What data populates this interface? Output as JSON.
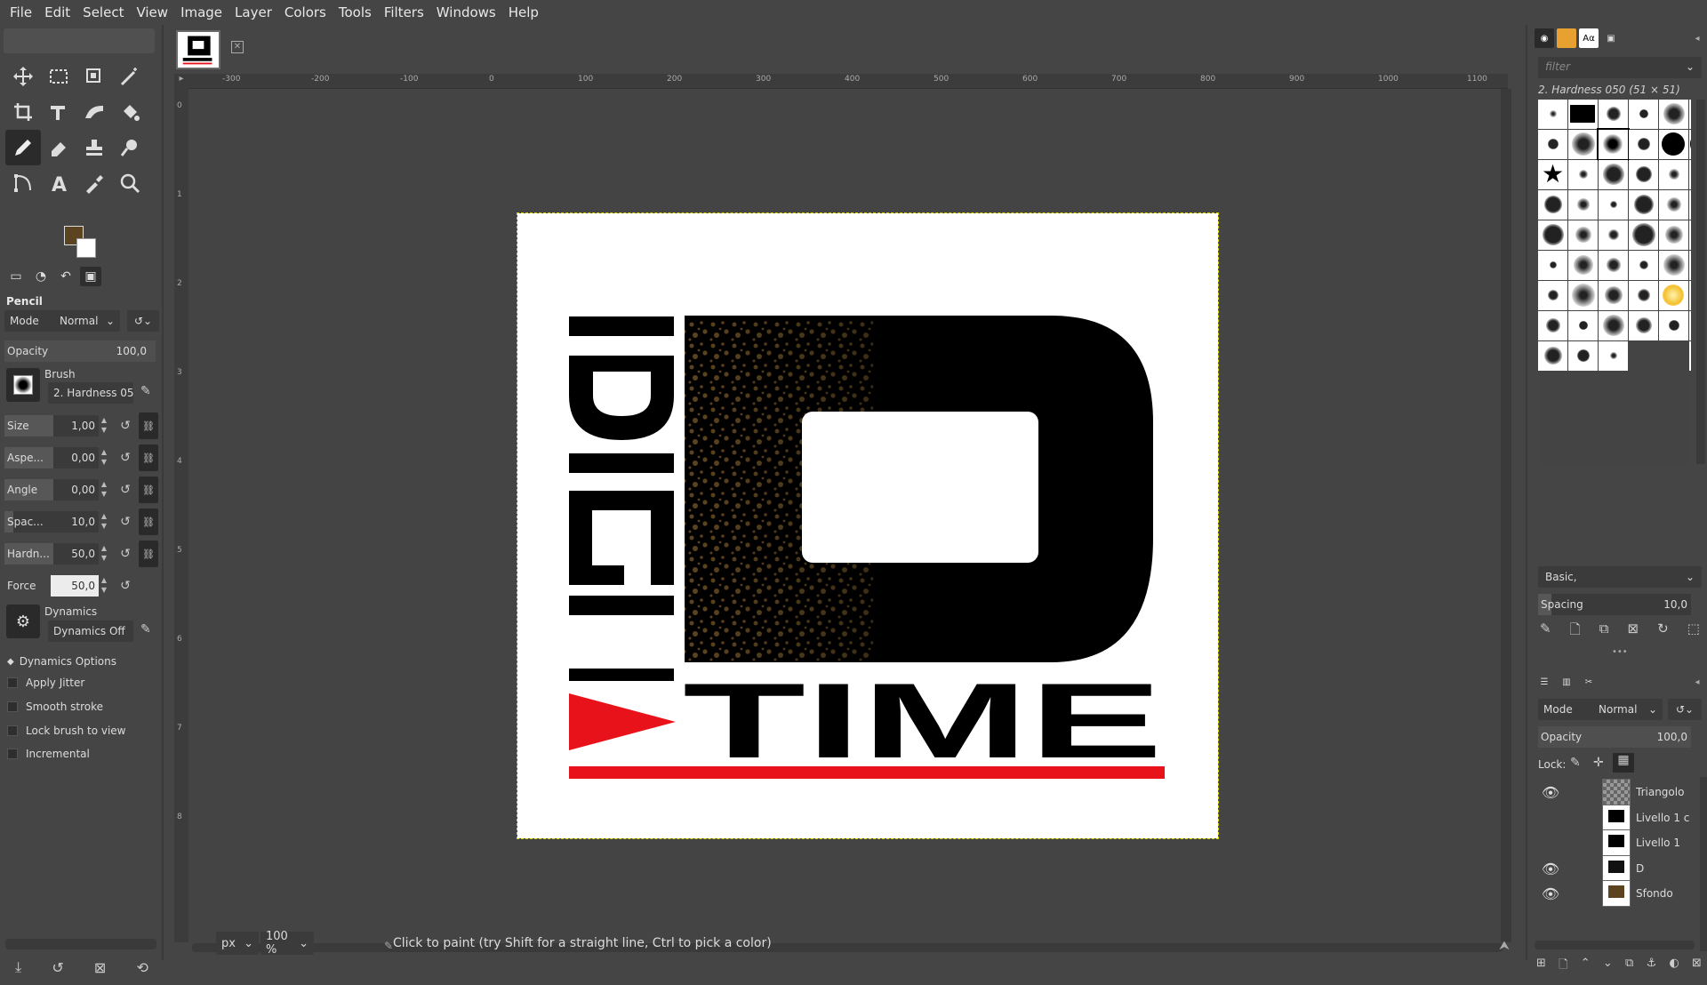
{
  "menu": [
    "File",
    "Edit",
    "Select",
    "View",
    "Image",
    "Layer",
    "Colors",
    "Tools",
    "Filters",
    "Windows",
    "Help"
  ],
  "colors": {
    "foreground": "#5d4420",
    "background": "#ffffff",
    "logo_red": "#e8121a"
  },
  "tool_options": {
    "title": "Pencil",
    "mode_label": "Mode",
    "mode_value": "Normal",
    "opacity_label": "Opacity",
    "opacity_value": "100,0",
    "brush_label": "Brush",
    "brush_value": "2. Hardness 050",
    "size_label": "Size",
    "size_value": "1,00",
    "aspect_label": "Aspe...",
    "aspect_value": "0,00",
    "angle_label": "Angle",
    "angle_value": "0,00",
    "spacing_label": "Spac...",
    "spacing_value": "10,0",
    "hardness_label": "Hardn...",
    "hardness_value": "50,0",
    "force_label": "Force",
    "force_value": "50,0",
    "dynamics_label": "Dynamics",
    "dynamics_value": "Dynamics Off",
    "dynamics_options": "Dynamics Options",
    "checks": [
      "Apply Jitter",
      "Smooth stroke",
      "Lock brush to view",
      "Incremental"
    ]
  },
  "ruler": [
    "-300",
    "-200",
    "-100",
    "0",
    "100",
    "200",
    "300",
    "400",
    "500",
    "600",
    "700",
    "800",
    "900",
    "1000",
    "1100"
  ],
  "vruler": [
    "0",
    "1",
    "2",
    "3",
    "4",
    "5",
    "6",
    "7",
    "8"
  ],
  "logo": {
    "text_time": "TIME",
    "text_vertical": "DIGI"
  },
  "statusbar": {
    "unit": "px",
    "zoom": "100 %",
    "message": "Click to paint (try Shift for a straight line, Ctrl to pick a color)"
  },
  "brushes": {
    "filter_placeholder": "filter",
    "selected": "2. Hardness 050 (51 × 51)",
    "set": "Basic,",
    "spacing_label": "Spacing",
    "spacing_value": "10,0"
  },
  "layers": {
    "mode_label": "Mode",
    "mode_value": "Normal",
    "opacity_label": "Opacity",
    "opacity_value": "100,0",
    "lock_label": "Lock:",
    "items": [
      {
        "name": "Triangolo",
        "visible": true
      },
      {
        "name": "Livello 1 c",
        "visible": false
      },
      {
        "name": "Livello 1",
        "visible": false
      },
      {
        "name": "D",
        "visible": true
      },
      {
        "name": "Sfondo",
        "visible": true
      }
    ]
  }
}
